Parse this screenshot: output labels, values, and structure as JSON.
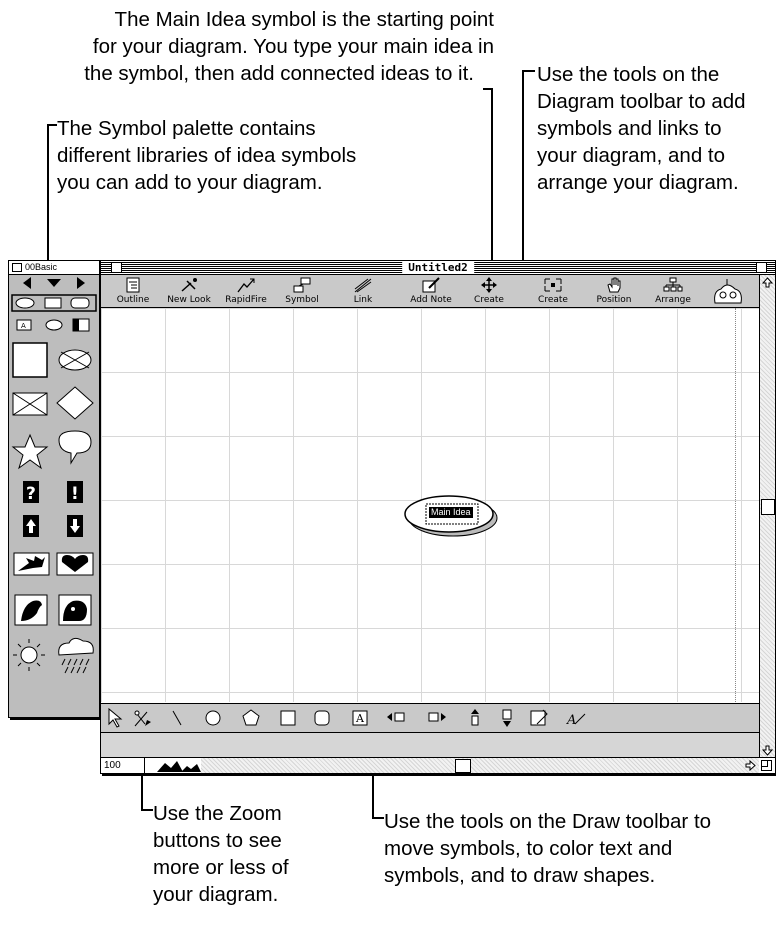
{
  "callouts": {
    "main_idea": [
      "The Main Idea symbol is the starting point",
      "for your diagram. You type your main idea in",
      "the symbol, then add connected ideas to it."
    ],
    "symbol_palette": [
      "The Symbol palette contains",
      "different libraries of idea symbols",
      "you can add to your diagram."
    ],
    "diagram_toolbar": [
      "Use the tools on the",
      "Diagram toolbar to add",
      "symbols and links to",
      "your diagram, and to",
      "arrange your diagram."
    ],
    "zoom": [
      "Use the Zoom",
      "buttons to see",
      "more or less of",
      "your diagram."
    ],
    "draw_toolbar": [
      "Use the tools on the Draw toolbar to",
      "move symbols, to color text and",
      "symbols, and to draw shapes."
    ]
  },
  "palette": {
    "library": "00Basic"
  },
  "window": {
    "title": "Untitled2"
  },
  "toolbar": {
    "tools": [
      {
        "label": "Outline",
        "icon": "outline-icon"
      },
      {
        "label": "New Look",
        "icon": "new-look-icon"
      },
      {
        "label": "RapidFire",
        "icon": "rapidfire-icon"
      },
      {
        "label": "Symbol",
        "icon": "symbol-icon"
      },
      {
        "label": "Link",
        "icon": "link-icon"
      },
      {
        "label": "Add Note",
        "icon": "add-note-icon"
      },
      {
        "label": "Create",
        "icon": "create-arrows-icon"
      },
      {
        "label": "Create",
        "icon": "create-expand-icon"
      },
      {
        "label": "Position",
        "icon": "hand-icon"
      },
      {
        "label": "Arrange",
        "icon": "arrange-icon"
      }
    ]
  },
  "canvas": {
    "main_idea_label": "Main Idea"
  },
  "zoom": {
    "value": "100"
  }
}
